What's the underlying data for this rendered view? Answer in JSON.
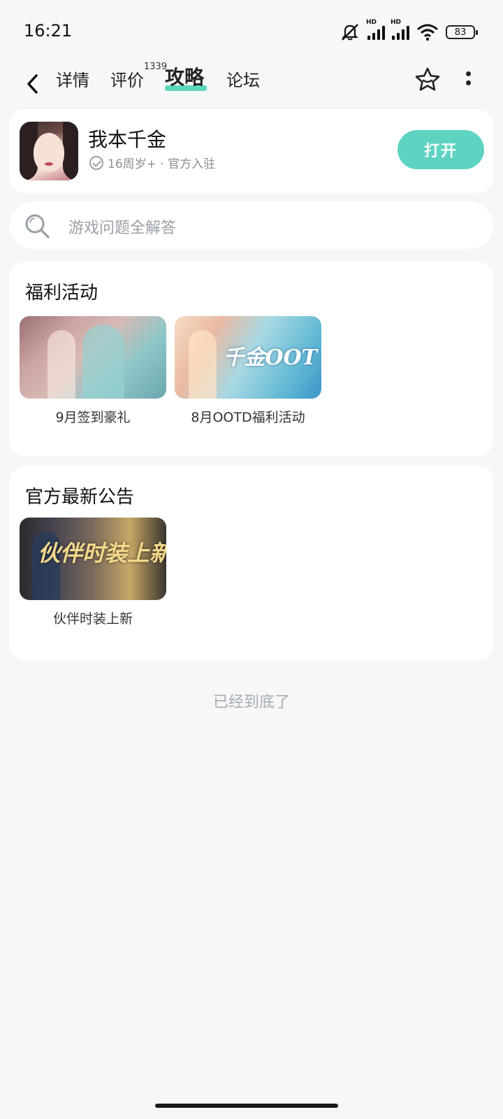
{
  "status_bar": {
    "time": "16:21",
    "battery": "83",
    "icons": [
      "mute-icon",
      "signal-icon",
      "signal-icon",
      "wifi-icon",
      "battery-icon"
    ],
    "hd_label": "HD"
  },
  "nav": {
    "tabs": [
      {
        "label": "详情"
      },
      {
        "label": "评价",
        "badge": "1339"
      },
      {
        "label": "攻略",
        "active": true
      },
      {
        "label": "论坛"
      }
    ],
    "accent_color": "#5dd6c0"
  },
  "app": {
    "name": "我本千金",
    "meta": "16周岁+ · 官方入驻",
    "open_label": "打开"
  },
  "search": {
    "placeholder": "游戏问题全解答"
  },
  "welfare": {
    "title": "福利活动",
    "items": [
      {
        "caption": "9月签到豪礼"
      },
      {
        "caption": "8月OOTD福利活动",
        "banner_text": "千金OOT"
      }
    ]
  },
  "notice": {
    "title": "官方最新公告",
    "items": [
      {
        "caption": "伙伴时装上新",
        "banner_text": "伙伴时装上新"
      }
    ]
  },
  "footer": {
    "end_text": "已经到底了"
  }
}
